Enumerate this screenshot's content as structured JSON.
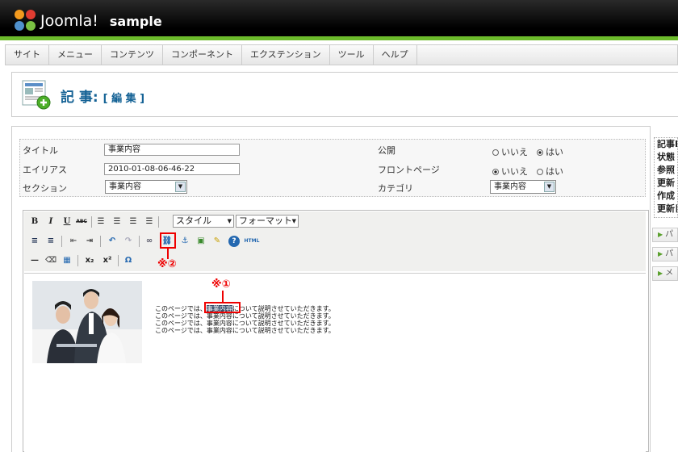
{
  "header": {
    "logo_text": "Joomla!",
    "site_name": "sample"
  },
  "menu": [
    "サイト",
    "メニュー",
    "コンテンツ",
    "コンポーネント",
    "エクステンション",
    "ツール",
    "ヘルプ"
  ],
  "page": {
    "title": "記 事:",
    "subtitle": "[ 編 集 ]"
  },
  "form": {
    "title_label": "タイトル",
    "title_value": "事業内容",
    "alias_label": "エイリアス",
    "alias_value": "2010-01-08-06-46-22",
    "section_label": "セクション",
    "section_value": "事業内容",
    "published_label": "公開",
    "published_no": "いいえ",
    "published_yes": "はい",
    "published_selected": "yes",
    "frontpage_label": "フロントページ",
    "frontpage_no": "いいえ",
    "frontpage_yes": "はい",
    "frontpage_selected": "no",
    "category_label": "カテゴリ",
    "category_value": "事業内容"
  },
  "editor": {
    "style_dropdown": "スタイル",
    "format_dropdown": "フォーマット",
    "html_button": "HTML",
    "body_lines": [
      {
        "before": "このページでは、",
        "highlight": "事業内容",
        "after": "について説明させていただきます。"
      },
      {
        "before": "このページでは、",
        "highlight": "事業内容",
        "after": "について説明させていただきます。"
      },
      {
        "before": "このページでは、",
        "highlight": "事業内容",
        "after": "について説明させていただきます。"
      },
      {
        "before": "このページでは、",
        "highlight": "事業内容",
        "after": "について説明させていただきます。"
      }
    ]
  },
  "annotations": {
    "note1": "※①",
    "note2": "※②"
  },
  "side": {
    "info_lines": [
      "記事I",
      "状態",
      "参照",
      "更新",
      "作成",
      "更新日"
    ],
    "buttons": [
      "パ",
      "パ",
      "メ"
    ]
  },
  "colors": {
    "accent_green": "#6cbb2b",
    "title_blue": "#146295",
    "annotation_red": "#ee0000"
  }
}
